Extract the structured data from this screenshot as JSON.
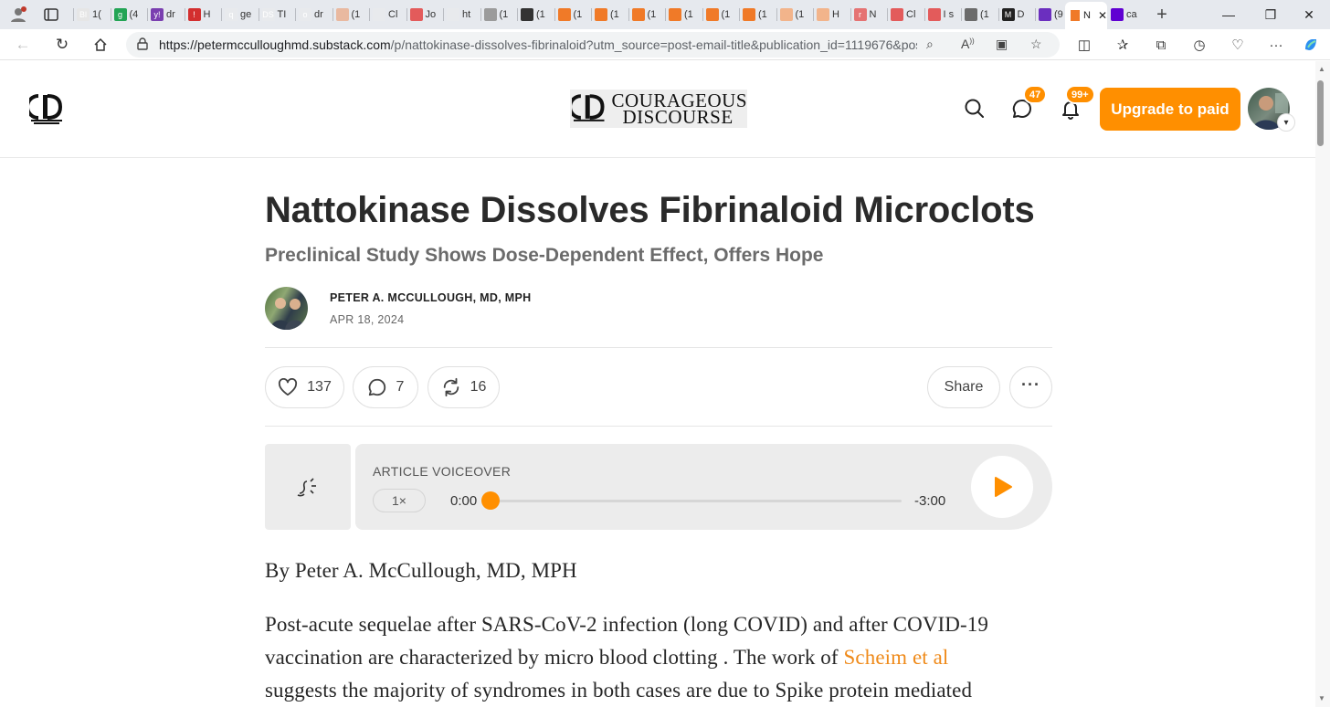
{
  "browser": {
    "mini_tabs": [
      {
        "label": "1(",
        "color": "#e6e6e6",
        "glyph": "Bl"
      },
      {
        "label": "(4",
        "color": "#23a455",
        "glyph": "g"
      },
      {
        "label": "dr",
        "color": "#7a3fb0",
        "glyph": "y!"
      },
      {
        "label": "H",
        "color": "#d32f2f",
        "glyph": "!"
      },
      {
        "label": "ge",
        "color": "#e8eaed",
        "glyph": "q"
      },
      {
        "label": "TI",
        "color": "#e8eaed",
        "glyph": "DS"
      },
      {
        "label": "dr",
        "color": "#e8eaed",
        "glyph": "o"
      },
      {
        "label": "(1",
        "color": "#e9b9a0",
        "glyph": ""
      },
      {
        "label": "Cl",
        "color": "#e8eaed",
        "glyph": ""
      },
      {
        "label": "Jo",
        "color": "#e35b5b",
        "glyph": ""
      },
      {
        "label": "ht",
        "color": "#e8eaed",
        "glyph": ""
      },
      {
        "label": "(1",
        "color": "#9b9b9b",
        "glyph": ""
      },
      {
        "label": "(1",
        "color": "#333333",
        "glyph": ""
      },
      {
        "label": "(1",
        "color": "#f07a28",
        "glyph": ""
      },
      {
        "label": "(1",
        "color": "#f07a28",
        "glyph": ""
      },
      {
        "label": "(1",
        "color": "#f07a28",
        "glyph": ""
      },
      {
        "label": "(1",
        "color": "#f07a28",
        "glyph": ""
      },
      {
        "label": "(1",
        "color": "#f07a28",
        "glyph": ""
      },
      {
        "label": "(1",
        "color": "#f07a28",
        "glyph": ""
      },
      {
        "label": "(1",
        "color": "#f2b48b",
        "glyph": ""
      },
      {
        "label": "H",
        "color": "#f2b48b",
        "glyph": ""
      },
      {
        "label": "N",
        "color": "#e57373",
        "glyph": "r"
      },
      {
        "label": "Cl",
        "color": "#e35b5b",
        "glyph": ""
      },
      {
        "label": "I s",
        "color": "#e35b5b",
        "glyph": ""
      },
      {
        "label": "(1",
        "color": "#6b6b6b",
        "glyph": ""
      },
      {
        "label": "D",
        "color": "#222222",
        "glyph": "M"
      },
      {
        "label": "(9",
        "color": "#6b2fbf",
        "glyph": ""
      }
    ],
    "active_tab_label": "N",
    "extra_tab_label": "ca",
    "url_domain": "https://petermcculloughmd.substack.com",
    "url_rest": "/p/nattokinase-dissolves-fibrinaloid?utm_source=post-email-title&publication_id=1119676&pos..."
  },
  "site": {
    "logo_line1": "Courageous",
    "logo_line2": "Discourse",
    "chat_badge": "47",
    "notif_badge": "99+",
    "upgrade_label": "Upgrade to paid"
  },
  "post": {
    "title": "Nattokinase Dissolves Fibrinaloid Microclots",
    "subtitle": "Preclinical Study Shows Dose-Dependent Effect, Offers Hope",
    "author": "PETER A. MCCULLOUGH, MD, MPH",
    "date": "APR 18, 2024",
    "likes": "137",
    "comments": "7",
    "restacks": "16",
    "share_label": "Share"
  },
  "voiceover": {
    "label": "ARTICLE VOICEOVER",
    "speed": "1×",
    "current_time": "0:00",
    "remaining_time": "-3:00",
    "progress": 0.0
  },
  "body": {
    "byline": "By Peter A. McCullough, MD, MPH",
    "p1_line1": "Post-acute sequelae after SARS-CoV-2 infection (long COVID) and after COVID-19",
    "p1_line2_a": "vaccination are characterized by micro blood clotting . The work of ",
    "p1_line2_link": "Scheim et al",
    "p1_line3": "suggests the majority of syndromes in both cases are due to Spike protein mediated"
  },
  "colors": {
    "accent": "#ff8f00",
    "link": "#ef8a1a"
  }
}
